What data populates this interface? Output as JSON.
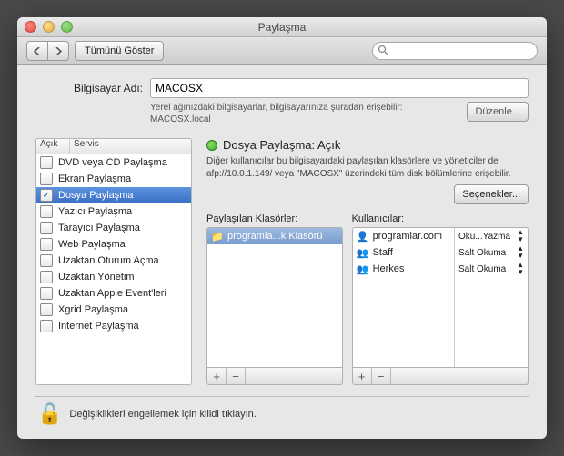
{
  "window_title": "Paylaşma",
  "toolbar": {
    "show_all": "Tümünü Göster",
    "search_placeholder": ""
  },
  "computer_name": {
    "label": "Bilgisayar Adı:",
    "value": "MACOSX",
    "subtitle": "Yerel ağınızdaki bilgisayarlar, bilgisayarınıza şuradan erişebilir: MACOSX.local",
    "edit": "Düzenle..."
  },
  "services": {
    "col_on": "Açık",
    "col_service": "Servis",
    "items": [
      {
        "label": "DVD veya CD Paylaşma",
        "on": false
      },
      {
        "label": "Ekran Paylaşma",
        "on": false
      },
      {
        "label": "Dosya Paylaşma",
        "on": true
      },
      {
        "label": "Yazıcı Paylaşma",
        "on": false
      },
      {
        "label": "Tarayıcı Paylaşma",
        "on": false
      },
      {
        "label": "Web Paylaşma",
        "on": false
      },
      {
        "label": "Uzaktan Oturum Açma",
        "on": false
      },
      {
        "label": "Uzaktan Yönetim",
        "on": false
      },
      {
        "label": "Uzaktan Apple Event'leri",
        "on": false
      },
      {
        "label": "Xgrid Paylaşma",
        "on": false
      },
      {
        "label": "Internet Paylaşma",
        "on": false
      }
    ]
  },
  "detail": {
    "status": "Dosya Paylaşma: Açık",
    "description": "Diğer kullanıcılar bu bilgisayardaki paylaşılan klasörlere ve yöneticiler de afp://10.0.1.149/ veya \"MACOSX\" üzerindeki tüm disk bölümlerine erişebilir.",
    "options": "Seçenekler..."
  },
  "shared_folders": {
    "label": "Paylaşılan Klasörler:",
    "items": [
      {
        "label": "programla...k Klasörü"
      }
    ]
  },
  "users": {
    "label": "Kullanıcılar:",
    "items": [
      {
        "name": "programlar.com",
        "perm": "Oku...Yazma"
      },
      {
        "name": "Staff",
        "perm": "Salt Okuma"
      },
      {
        "name": "Herkes",
        "perm": "Salt Okuma"
      }
    ]
  },
  "lock_text": "Değişiklikleri engellemek için kilidi tıklayın."
}
